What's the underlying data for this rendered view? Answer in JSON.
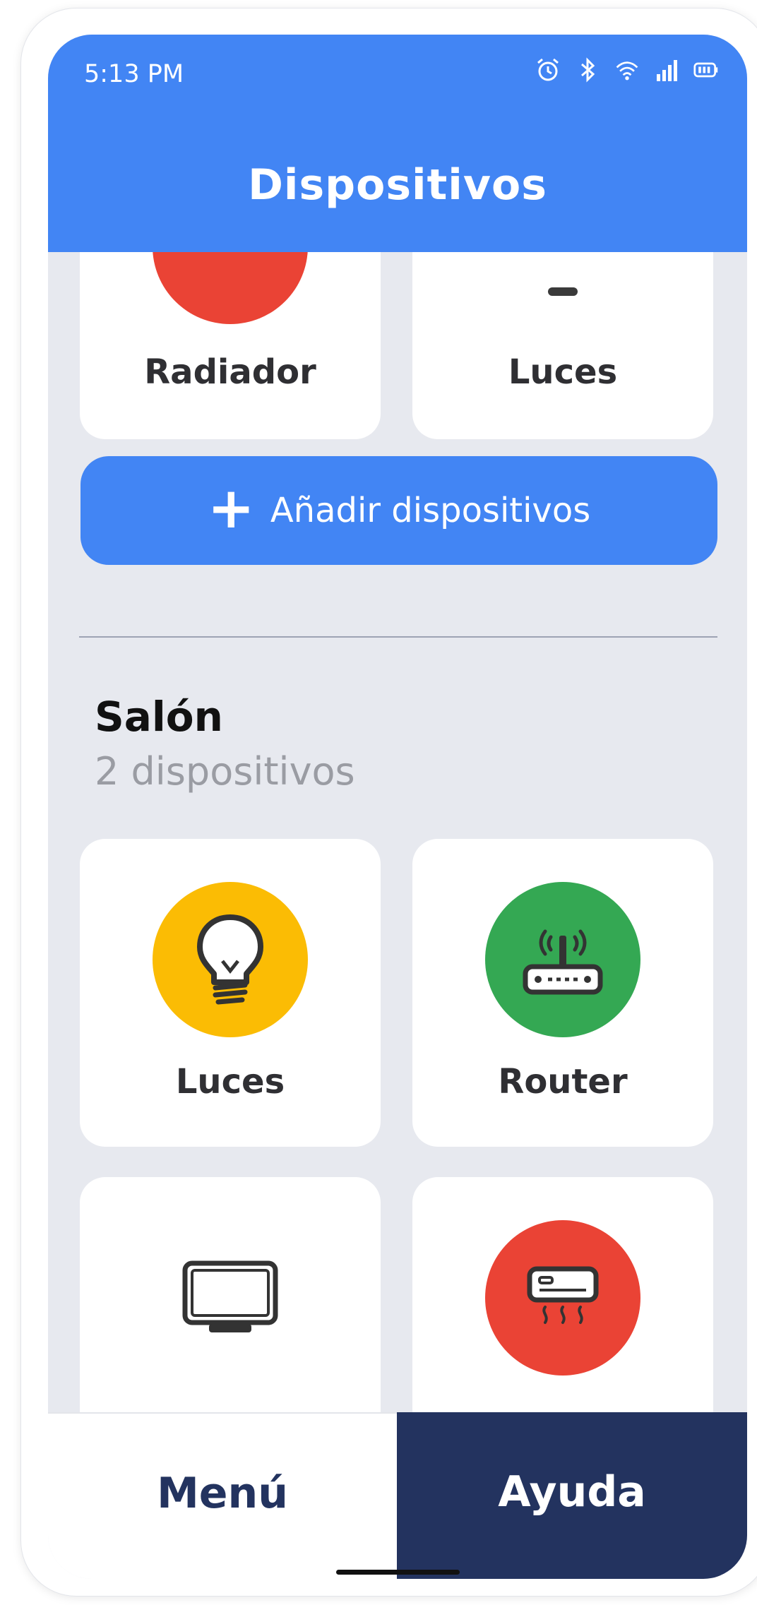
{
  "status_bar": {
    "time": "5:13 PM",
    "icons": [
      "alarm-icon",
      "bluetooth-icon",
      "wifi-icon",
      "signal-icon",
      "battery-icon"
    ]
  },
  "header": {
    "title": "Dispositivos"
  },
  "previous_group": {
    "devices": [
      {
        "label": "Radiador",
        "icon": "radiator-icon",
        "color": "#ea4335"
      },
      {
        "label": "Luces",
        "icon": "light-icon"
      }
    ]
  },
  "add_button": {
    "label": "Añadir dispositivos",
    "icon": "plus-icon"
  },
  "group": {
    "title": "Salón",
    "subtitle": "2 dispositivos",
    "devices": [
      {
        "label": "Luces",
        "icon": "light-bulb-icon",
        "color": "#fbbc04"
      },
      {
        "label": "Router",
        "icon": "router-icon",
        "color": "#34a853"
      },
      {
        "label": "",
        "icon": "tv-icon"
      },
      {
        "label": "",
        "icon": "air-conditioner-icon",
        "color": "#ea4335"
      }
    ]
  },
  "bottom_nav": {
    "menu": "Menú",
    "help": "Ayuda"
  },
  "colors": {
    "primary": "#4285f4",
    "navy": "#23335f",
    "background": "#e7e9ef"
  }
}
